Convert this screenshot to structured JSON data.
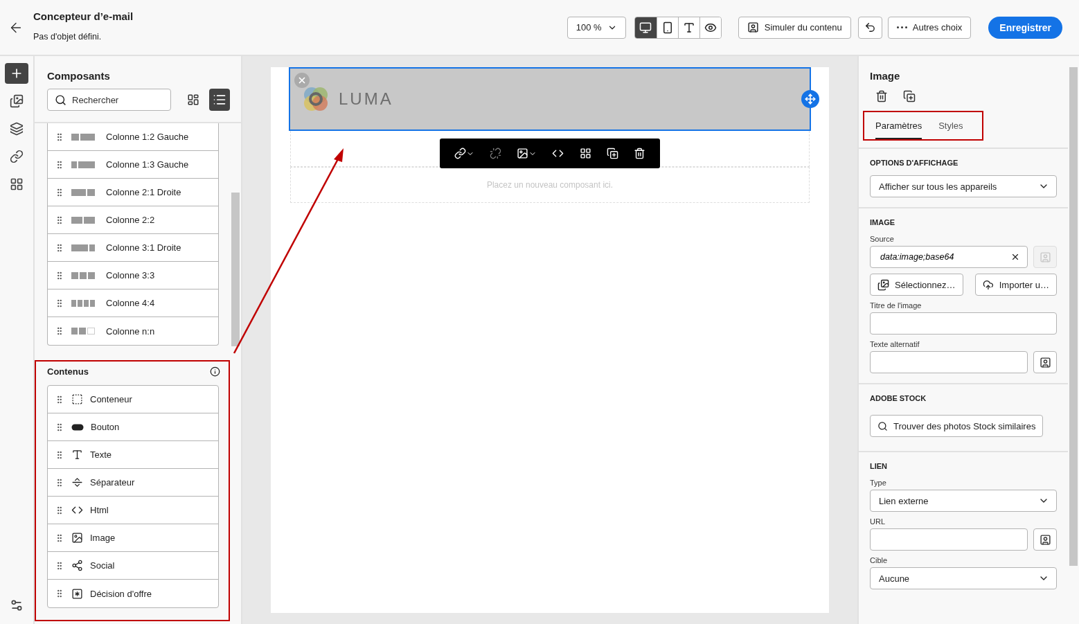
{
  "header": {
    "title": "Concepteur d’e-mail",
    "subtitle": "Pas d'objet défini.",
    "zoom": "100 %",
    "view_modes": [
      {
        "kind": "desktop",
        "selected": true
      },
      {
        "kind": "mobile",
        "selected": false
      },
      {
        "kind": "text",
        "selected": false
      },
      {
        "kind": "preview",
        "selected": false
      }
    ],
    "simulate_button": "Simuler du contenu",
    "more_button": "Autres choix",
    "save_button": "Enregistrer"
  },
  "rail": {
    "items": [
      {
        "kind": "add",
        "selected": true
      },
      {
        "kind": "assets",
        "selected": false
      },
      {
        "kind": "layers",
        "selected": false
      },
      {
        "kind": "links",
        "selected": false
      },
      {
        "kind": "fragments",
        "selected": false
      }
    ],
    "bottom": {
      "kind": "settings",
      "selected": false
    }
  },
  "components": {
    "title": "Composants",
    "search": {
      "placeholder": "Rechercher"
    },
    "view_toggle": [
      {
        "kind": "grid",
        "selected": false
      },
      {
        "kind": "list",
        "selected": true
      }
    ],
    "structures": [
      {
        "label": "Colonne 1:2 Gauche",
        "kind": "c12"
      },
      {
        "label": "Colonne 1:3 Gauche",
        "kind": "c13"
      },
      {
        "label": "Colonne 2:1 Droite",
        "kind": "c21"
      },
      {
        "label": "Colonne 2:2",
        "kind": "c22"
      },
      {
        "label": "Colonne 3:1 Droite",
        "kind": "c31"
      },
      {
        "label": "Colonne 3:3",
        "kind": "c33"
      },
      {
        "label": "Colonne 4:4",
        "kind": "c44"
      },
      {
        "label": "Colonne n:n",
        "kind": "cnn"
      }
    ],
    "contents": {
      "title": "Contenus",
      "items": [
        {
          "label": "Conteneur",
          "kind": "container"
        },
        {
          "label": "Bouton",
          "kind": "button"
        },
        {
          "label": "Texte",
          "kind": "text"
        },
        {
          "label": "Séparateur",
          "kind": "separator"
        },
        {
          "label": "Html",
          "kind": "html"
        },
        {
          "label": "Image",
          "kind": "image"
        },
        {
          "label": "Social",
          "kind": "social"
        },
        {
          "label": "Décision d'offre",
          "kind": "offer"
        }
      ]
    }
  },
  "canvas": {
    "logo": "LUMA",
    "drop_hint": "Placez un nouveau composant ici."
  },
  "properties": {
    "title": "Image",
    "tabs": [
      {
        "label": "Paramètres",
        "selected": true
      },
      {
        "label": "Styles",
        "selected": false
      }
    ],
    "sections": [
      {
        "heading": "OPTIONS D'AFFICHAGE",
        "items": [
          {
            "kind": "select",
            "value": "Afficher sur tous les appareils"
          }
        ]
      },
      {
        "heading": "IMAGE",
        "items": [
          {
            "kind": "input",
            "label": "Source",
            "value": "data:image;base64",
            "clearable": true,
            "side_button": {
              "disabled": true
            }
          },
          {
            "kind": "buttons",
            "buttons": [
              {
                "label": "Sélectionnez…",
                "kind": "select"
              },
              {
                "label": "Importer u…",
                "kind": "upload"
              }
            ]
          },
          {
            "kind": "input",
            "label": "Titre de l'image"
          },
          {
            "kind": "input",
            "label": "Texte alternatif",
            "side_button": {
              "disabled": false
            }
          }
        ]
      },
      {
        "heading": "ADOBE STOCK",
        "items": [
          {
            "kind": "button",
            "label": "Trouver des photos Stock similaires"
          }
        ]
      },
      {
        "heading": "LIEN",
        "items": [
          {
            "kind": "select",
            "label": "Type",
            "value": "Lien externe"
          },
          {
            "kind": "input",
            "label": "URL",
            "side_button": {
              "disabled": false
            }
          },
          {
            "kind": "select",
            "label": "Cible",
            "value": "Aucune"
          }
        ]
      }
    ]
  }
}
